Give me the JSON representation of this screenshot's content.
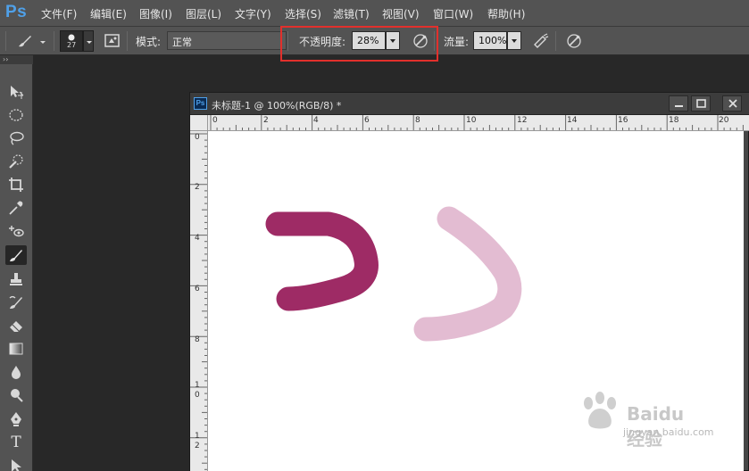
{
  "app": {
    "logo": "Ps"
  },
  "menu": [
    "文件(F)",
    "编辑(E)",
    "图像(I)",
    "图层(L)",
    "文字(Y)",
    "选择(S)",
    "滤镜(T)",
    "视图(V)",
    "窗口(W)",
    "帮助(H)"
  ],
  "options": {
    "brush_size": "27",
    "mode_label": "模式:",
    "mode_value": "正常",
    "opacity_label": "不透明度:",
    "opacity_value": "28%",
    "flow_label": "流量:",
    "flow_value": "100%"
  },
  "toolbox": {
    "grip": "››",
    "tools": [
      "move-tool-icon",
      "marquee-tool-icon",
      "lasso-tool-icon",
      "quick-select-tool-icon",
      "crop-tool-icon",
      "eyedropper-tool-icon",
      "spot-healing-tool-icon",
      "brush-tool-icon",
      "clone-stamp-tool-icon",
      "history-brush-tool-icon",
      "eraser-tool-icon",
      "gradient-tool-icon",
      "blur-tool-icon",
      "dodge-tool-icon",
      "pen-tool-icon",
      "type-tool-icon",
      "path-select-tool-icon"
    ],
    "type_glyph": "T"
  },
  "document": {
    "icon": "Ps",
    "title": "未标题-1 @ 100%(RGB/8) *",
    "ruler_top": [
      "0",
      "2",
      "4",
      "6",
      "8",
      "10",
      "12",
      "14",
      "16",
      "18",
      "20"
    ],
    "ruler_left": [
      "0",
      "2",
      "4",
      "6",
      "8",
      "10",
      "12"
    ],
    "strokes": [
      {
        "name": "dark-stroke",
        "color": "#9e2b65",
        "opacity": "100%"
      },
      {
        "name": "light-stroke",
        "color": "#e3bcd2",
        "opacity": "28%"
      }
    ]
  },
  "colors": {
    "highlight": "#e2302c",
    "accent": "#4fa0e8"
  },
  "watermark": {
    "text": "Baidu经验",
    "url": "jingyan.baidu.com"
  }
}
